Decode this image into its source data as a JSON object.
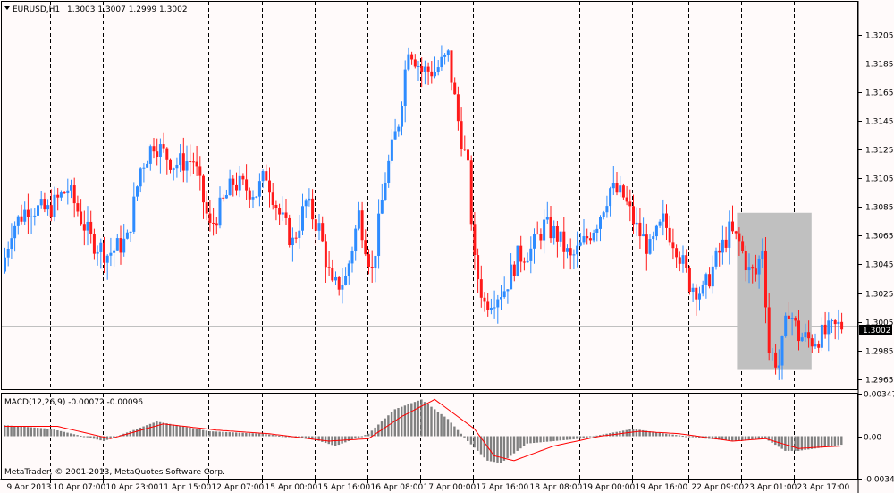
{
  "header": {
    "symbol": "EURUSD,H1",
    "ohlc": "1.3003 1.3007 1.2999 1.3002",
    "current_price": "1.3002"
  },
  "macd": {
    "label": "MACD(12,26,9) -0.00072 -0.00096",
    "ticks": [
      "0.00347",
      "0.00",
      "-0.00347"
    ],
    "tick_values": [
      0.00347,
      0,
      -0.00347
    ]
  },
  "copyright": "MetaTrader, © 2001-2013, MetaQuotes Software Corp.",
  "colors": {
    "background": "#fffafa",
    "bull": "#2e8cff",
    "bear": "#ff1a1a",
    "macd_hist": "#808080",
    "signal": "#ff0000",
    "highlight": "#c0c0c0",
    "current_line": "#c0c0c0"
  },
  "chart_data": [
    {
      "type": "candlestick",
      "title": "EURUSD,H1",
      "price_axis_ticks": [
        "1.3205",
        "1.3185",
        "1.3165",
        "1.3145",
        "1.3125",
        "1.3105",
        "1.3085",
        "1.3065",
        "1.3045",
        "1.3025",
        "1.3005",
        "1.2985",
        "1.2965"
      ],
      "ylim": [
        1.2958,
        1.3228
      ],
      "x_tick_labels": [
        "9 Apr 2013",
        "10 Apr 07:00",
        "10 Apr 23:00",
        "11 Apr 15:00",
        "12 Apr 07:00",
        "15 Apr 00:00",
        "15 Apr 16:00",
        "16 Apr 08:00",
        "17 Apr 00:00",
        "17 Apr 16:00",
        "18 Apr 08:00",
        "19 Apr 00:00",
        "19 Apr 16:00",
        "22 Apr 09:00",
        "23 Apr 01:00",
        "23 Apr 17:00"
      ],
      "x_tick_bar_index": [
        0,
        14,
        30,
        46,
        62,
        78,
        94,
        110,
        126,
        142,
        158,
        174,
        190,
        207,
        223,
        239
      ],
      "anchors": [
        [
          0,
          1.304
        ],
        [
          3,
          1.307
        ],
        [
          8,
          1.3085
        ],
        [
          14,
          1.3082
        ],
        [
          20,
          1.3098
        ],
        [
          27,
          1.3062
        ],
        [
          32,
          1.3052
        ],
        [
          38,
          1.3062
        ],
        [
          42,
          1.3112
        ],
        [
          46,
          1.313
        ],
        [
          52,
          1.3115
        ],
        [
          58,
          1.3118
        ],
        [
          63,
          1.307
        ],
        [
          70,
          1.3102
        ],
        [
          77,
          1.3095
        ],
        [
          80,
          1.3108
        ],
        [
          84,
          1.308
        ],
        [
          88,
          1.306
        ],
        [
          92,
          1.3088
        ],
        [
          96,
          1.307
        ],
        [
          100,
          1.3028
        ],
        [
          104,
          1.3035
        ],
        [
          108,
          1.308
        ],
        [
          112,
          1.304
        ],
        [
          116,
          1.3105
        ],
        [
          120,
          1.3145
        ],
        [
          123,
          1.3198
        ],
        [
          127,
          1.318
        ],
        [
          131,
          1.318
        ],
        [
          135,
          1.319
        ],
        [
          138,
          1.3145
        ],
        [
          141,
          1.311
        ],
        [
          143,
          1.3045
        ],
        [
          146,
          1.3018
        ],
        [
          152,
          1.3028
        ],
        [
          156,
          1.305
        ],
        [
          160,
          1.3055
        ],
        [
          164,
          1.3072
        ],
        [
          168,
          1.3065
        ],
        [
          172,
          1.3048
        ],
        [
          176,
          1.306
        ],
        [
          180,
          1.3075
        ],
        [
          184,
          1.3098
        ],
        [
          188,
          1.3092
        ],
        [
          192,
          1.307
        ],
        [
          196,
          1.3055
        ],
        [
          200,
          1.3075
        ],
        [
          204,
          1.3058
        ],
        [
          208,
          1.3032
        ],
        [
          212,
          1.3025
        ],
        [
          216,
          1.3048
        ],
        [
          220,
          1.3068
        ],
        [
          223,
          1.306
        ],
        [
          226,
          1.304
        ],
        [
          228,
          1.3038
        ],
        [
          230,
          1.3058
        ],
        [
          232,
          1.2985
        ],
        [
          235,
          1.2975
        ],
        [
          238,
          1.3015
        ],
        [
          241,
          1.2995
        ],
        [
          245,
          1.2992
        ],
        [
          250,
          1.2998
        ],
        [
          253,
          1.3002
        ]
      ],
      "current_price": 1.3002,
      "highlight_zone": {
        "bars": [
          222,
          244
        ],
        "price": [
          1.2972,
          1.3081
        ]
      }
    },
    {
      "type": "bar",
      "title": "MACD(12,26,9)",
      "ylim": [
        -0.00347,
        0.00347
      ],
      "series": [
        {
          "name": "MACD",
          "kind": "histogram",
          "anchors": [
            [
              0,
              0.0009
            ],
            [
              14,
              0.0006
            ],
            [
              30,
              -0.0004
            ],
            [
              46,
              0.0012
            ],
            [
              62,
              0.0004
            ],
            [
              78,
              0.0002
            ],
            [
              94,
              -0.0003
            ],
            [
              100,
              -0.0008
            ],
            [
              110,
              0.0002
            ],
            [
              118,
              0.0022
            ],
            [
              126,
              0.003
            ],
            [
              134,
              0.0014
            ],
            [
              140,
              -0.0004
            ],
            [
              146,
              -0.002
            ],
            [
              150,
              -0.0022
            ],
            [
              158,
              -0.0006
            ],
            [
              174,
              -0.0002
            ],
            [
              190,
              0.0006
            ],
            [
              200,
              0.0002
            ],
            [
              212,
              -0.0002
            ],
            [
              222,
              -0.0004
            ],
            [
              230,
              -0.0002
            ],
            [
              236,
              -0.0012
            ],
            [
              240,
              -0.0012
            ],
            [
              253,
              -0.0007
            ]
          ]
        },
        {
          "name": "Signal",
          "kind": "line",
          "anchors": [
            [
              0,
              0.0008
            ],
            [
              16,
              0.0008
            ],
            [
              32,
              -0.0002
            ],
            [
              48,
              0.001
            ],
            [
              64,
              0.0005
            ],
            [
              80,
              0.0002
            ],
            [
              98,
              -0.0004
            ],
            [
              110,
              -0.0002
            ],
            [
              120,
              0.0016
            ],
            [
              130,
              0.003
            ],
            [
              142,
              0.0006
            ],
            [
              148,
              -0.0016
            ],
            [
              154,
              -0.002
            ],
            [
              166,
              -0.0008
            ],
            [
              180,
              0.0
            ],
            [
              192,
              0.0004
            ],
            [
              204,
              0.0002
            ],
            [
              220,
              -0.0004
            ],
            [
              230,
              -0.0002
            ],
            [
              240,
              -0.001
            ],
            [
              253,
              -0.0008
            ]
          ]
        }
      ]
    }
  ]
}
